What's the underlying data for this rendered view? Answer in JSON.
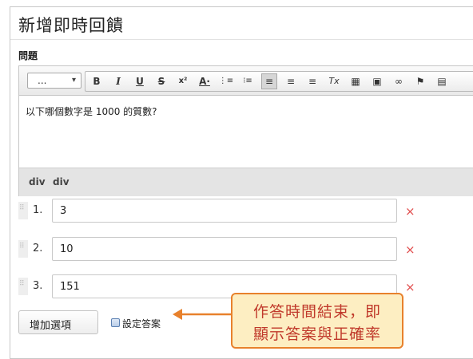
{
  "window": {
    "title": "新增即時回饋"
  },
  "question": {
    "label": "問題",
    "format_select": "...",
    "toolbar": [
      {
        "name": "bold-icon",
        "glyph": "B"
      },
      {
        "name": "italic-icon",
        "glyph": "I"
      },
      {
        "name": "underline-icon",
        "glyph": "U"
      },
      {
        "name": "strikethrough-icon",
        "glyph": "S"
      },
      {
        "name": "superscript-icon",
        "glyph": "x²"
      },
      {
        "name": "font-color-icon",
        "glyph": "A·"
      },
      {
        "name": "numbered-list-icon",
        "glyph": "⋮≡"
      },
      {
        "name": "bulleted-list-icon",
        "glyph": "⁝≡"
      },
      {
        "name": "align-left-icon",
        "glyph": "≡"
      },
      {
        "name": "align-center-icon",
        "glyph": "≡"
      },
      {
        "name": "align-right-icon",
        "glyph": "≡"
      },
      {
        "name": "clear-format-icon",
        "glyph": "Tx"
      },
      {
        "name": "table-icon",
        "glyph": "▦"
      },
      {
        "name": "image-icon",
        "glyph": "▣"
      },
      {
        "name": "link-icon",
        "glyph": "∞"
      },
      {
        "name": "flag-icon",
        "glyph": "⚑"
      },
      {
        "name": "save-icon",
        "glyph": "▤"
      }
    ],
    "content": "以下哪個數字是 1000 的質數?",
    "path": [
      "div",
      "div"
    ]
  },
  "options": [
    {
      "number": "1.",
      "value": "3"
    },
    {
      "number": "2.",
      "value": "10"
    },
    {
      "number": "3.",
      "value": "151"
    }
  ],
  "delete_icon": "×",
  "add_option_label": "增加選項",
  "set_answer_label": "設定答案",
  "callout": {
    "line1": "作答時間結束，即",
    "line2": "顯示答案與正確率"
  },
  "colors": {
    "callout_border": "#e8812c",
    "callout_fill": "#fdeec2",
    "callout_text": "#c0392b",
    "delete": "#e14b4b"
  }
}
